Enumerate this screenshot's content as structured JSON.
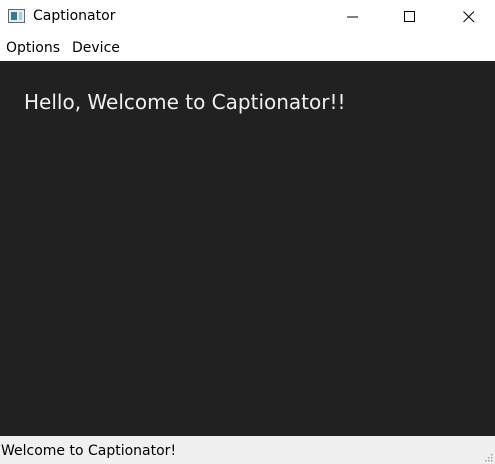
{
  "window": {
    "title": "Captionator"
  },
  "menu": {
    "items": [
      {
        "label": "Options"
      },
      {
        "label": "Device"
      }
    ]
  },
  "main": {
    "heading": "Hello, Welcome to Captionator!!"
  },
  "status": {
    "text": "Welcome to Captionator!"
  },
  "colors": {
    "content_background": "#212121",
    "heading_text": "#f0f0f0",
    "statusbar_background": "#f0f0f0"
  },
  "icons": {
    "app": "app-icon",
    "minimize": "minimize-icon",
    "maximize": "maximize-icon",
    "close": "close-icon",
    "size_grip": "size-grip-icon"
  }
}
